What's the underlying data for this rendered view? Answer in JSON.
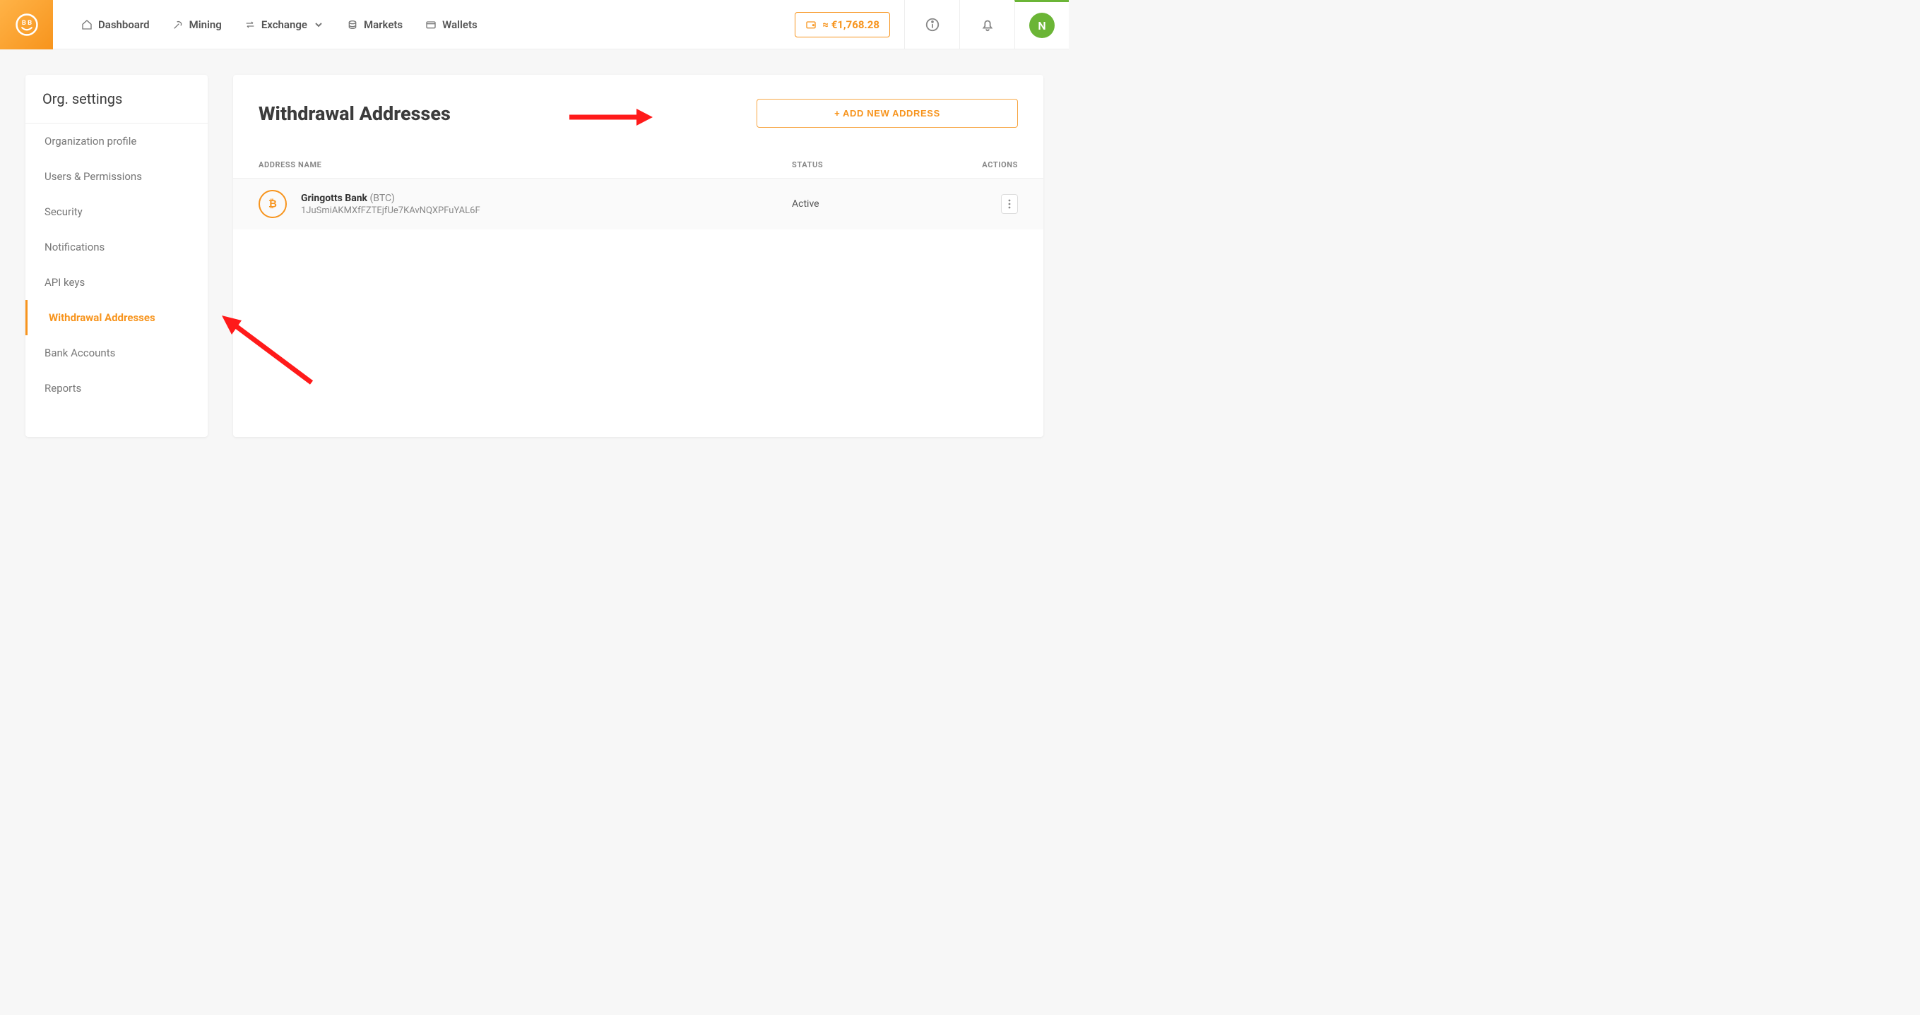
{
  "nav": {
    "dashboard": "Dashboard",
    "mining": "Mining",
    "exchange": "Exchange",
    "markets": "Markets",
    "wallets": "Wallets",
    "balance": "≈ €1,768.28",
    "avatar_initial": "N"
  },
  "sidebar": {
    "header": "Org. settings",
    "items": [
      "Organization profile",
      "Users & Permissions",
      "Security",
      "Notifications",
      "API keys",
      "Withdrawal Addresses",
      "Bank Accounts",
      "Reports"
    ],
    "active_index": 5
  },
  "panel": {
    "title": "Withdrawal Addresses",
    "add_button": "+ ADD NEW ADDRESS",
    "columns": {
      "name": "ADDRESS NAME",
      "status": "STATUS",
      "actions": "ACTIONS"
    },
    "rows": [
      {
        "coin": "BTC",
        "label": "Gringotts Bank",
        "symbol": "(BTC)",
        "address": "1JuSmiAKMXfFZTEjfUe7KAvNQXPFuYAL6F",
        "status": "Active"
      }
    ]
  }
}
